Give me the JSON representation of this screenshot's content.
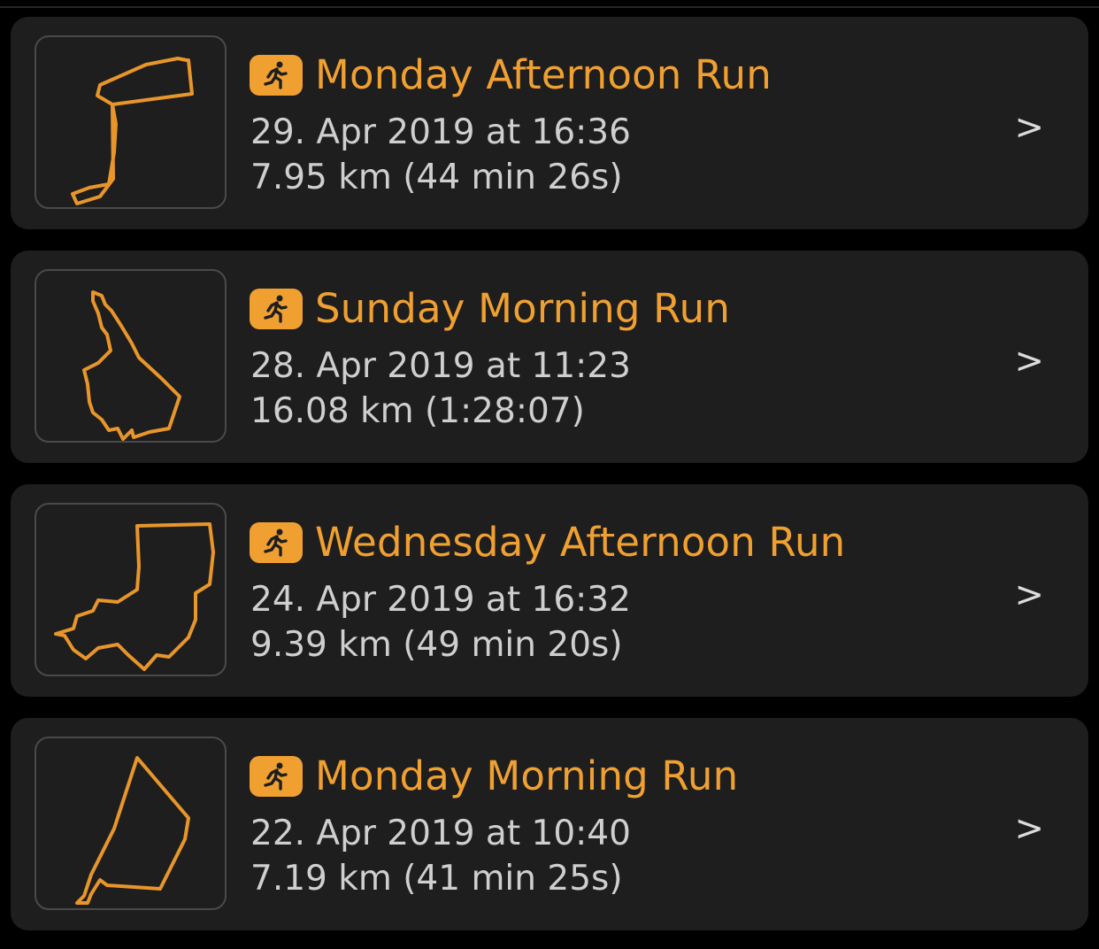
{
  "colors": {
    "background": "#000000",
    "card": "#1e1e1e",
    "accent": "#f0a030",
    "text_secondary": "#cfcfcf",
    "thumb_border": "#4a4a4a"
  },
  "activity_icon": "running-figure-icon",
  "chevron_label": ">",
  "activities": [
    {
      "title": "Monday Afternoon Run",
      "date": "29. Apr 2019 at 16:36",
      "stats": "7.95 km (44 min 26s)"
    },
    {
      "title": "Sunday Morning Run",
      "date": "28. Apr 2019 at 11:23",
      "stats": "16.08 km (1:28:07)"
    },
    {
      "title": "Wednesday Afternoon Run",
      "date": "24. Apr 2019 at 16:32",
      "stats": "9.39 km (49 min 20s)"
    },
    {
      "title": "Monday Morning Run",
      "date": "22. Apr 2019 at 10:40",
      "stats": "7.19 km (41 min 25s)"
    }
  ]
}
